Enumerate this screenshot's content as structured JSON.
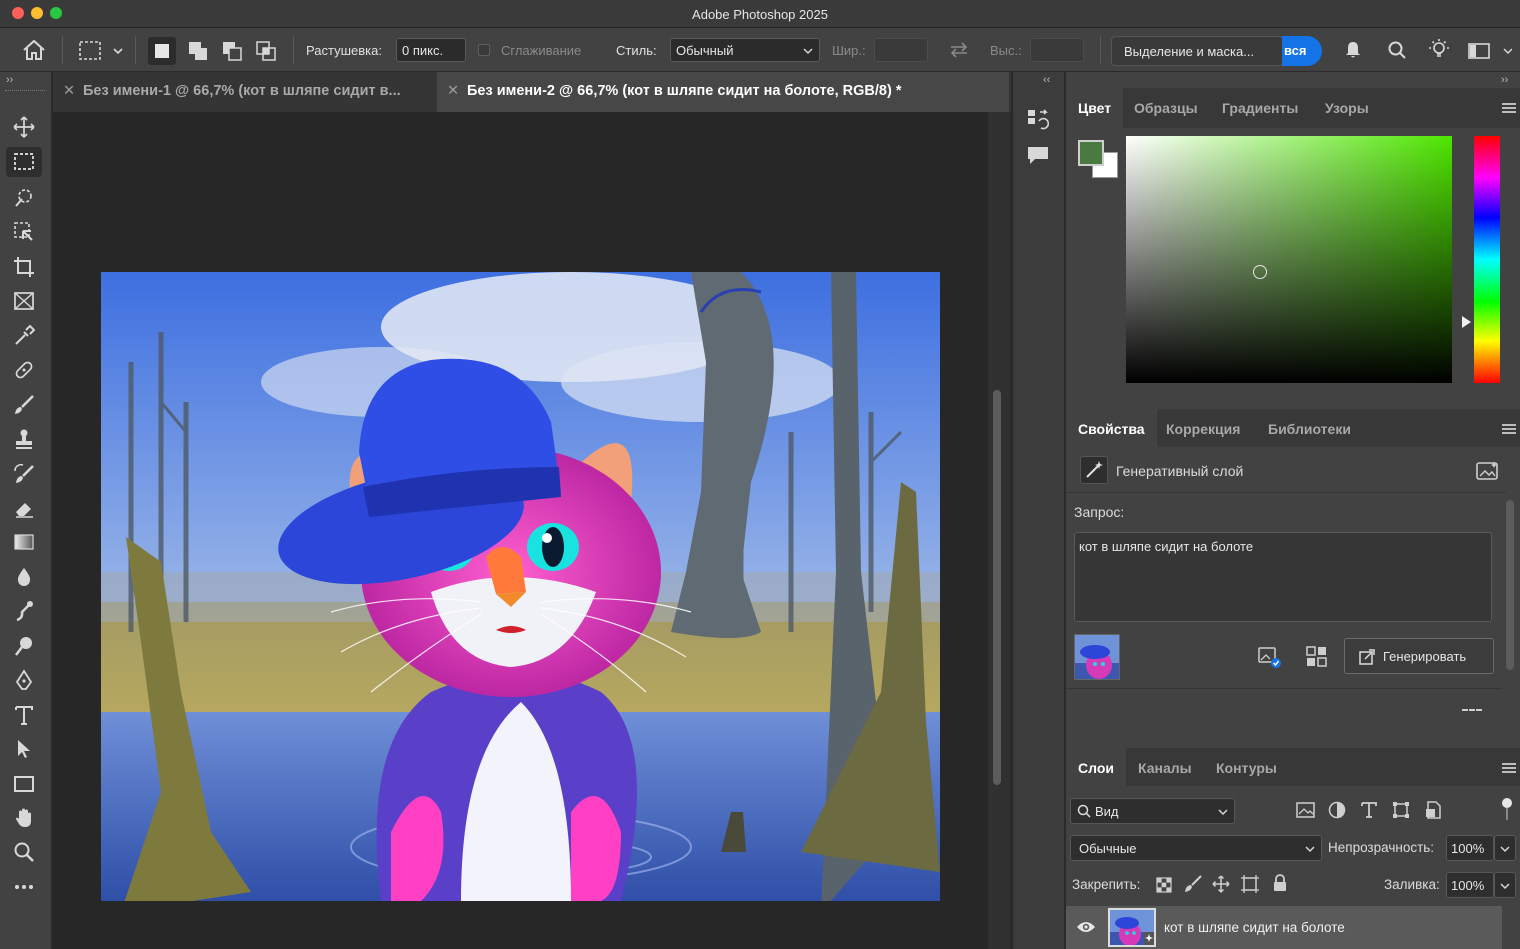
{
  "window": {
    "title": "Adobe Photoshop 2025"
  },
  "options_bar": {
    "feather_label": "Растушевка:",
    "feather_value": "0 пикс.",
    "antialias_label": "Сглаживание",
    "style_label": "Стиль:",
    "style_value": "Обычный",
    "width_label": "Шир.:",
    "height_label": "Выс.:",
    "select_mask_label": "Выделение и маска...",
    "select_subject_label": "вся"
  },
  "tabs": [
    {
      "label": "Без имени-1 @ 66,7% (кот в шляпе сидит в...",
      "active": false
    },
    {
      "label": "Без имени-2 @ 66,7% (кот в шляпе сидит на болоте, RGB/8) *",
      "active": true
    }
  ],
  "color_panel": {
    "tabs": [
      "Цвет",
      "Образцы",
      "Градиенты",
      "Узоры"
    ],
    "foreground_color": "#4a7a3f",
    "background_color": "#ffffff",
    "hue_color": "#4ee600"
  },
  "properties_panel": {
    "tabs": [
      "Свойства",
      "Коррекция",
      "Библиотеки"
    ],
    "layer_type": "Генеративный слой",
    "prompt_label": "Запрос:",
    "prompt_text": "кот в шляпе сидит на болоте",
    "generate_label": "Генерировать"
  },
  "layers_panel": {
    "tabs": [
      "Слои",
      "Каналы",
      "Контуры"
    ],
    "filter_label": "Вид",
    "blend_mode": "Обычные",
    "opacity_label": "Непрозрачность:",
    "opacity_value": "100%",
    "lock_label": "Закрепить:",
    "fill_label": "Заливка:",
    "fill_value": "100%",
    "layers": [
      {
        "name": "кот в шляпе сидит на болоте",
        "visible": true
      }
    ]
  }
}
